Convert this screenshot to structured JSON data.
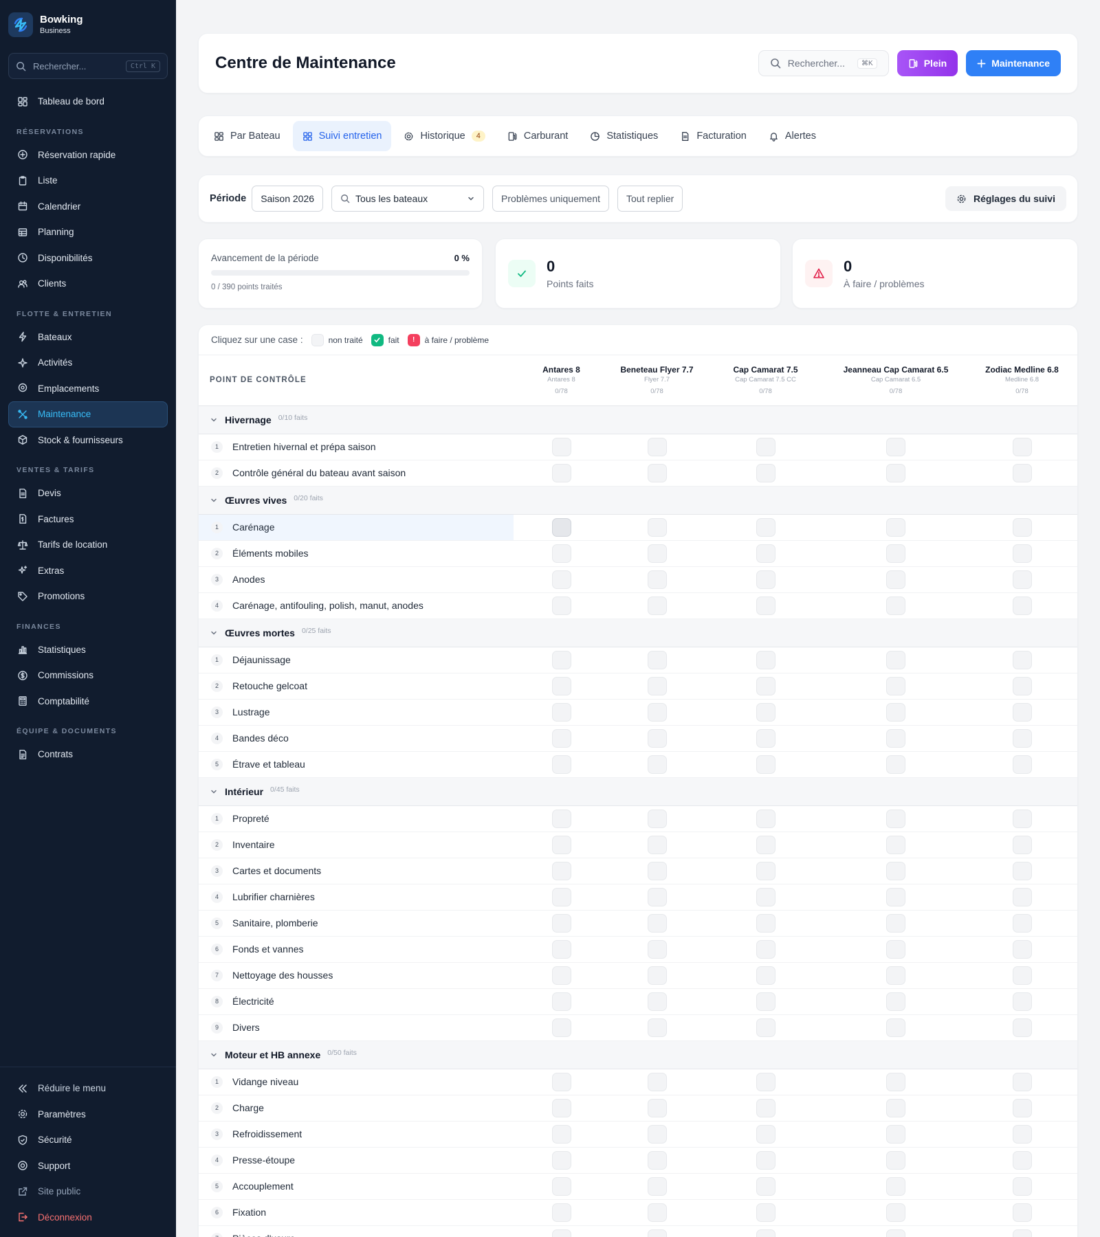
{
  "sidebar": {
    "brand_name": "Bowking",
    "brand_sub": "Business",
    "search_placeholder": "Rechercher...",
    "search_shortcut": "Ctrl K",
    "dashboard": "Tableau de bord",
    "sections": [
      {
        "title": "RÉSERVATIONS",
        "items": [
          {
            "label": "Réservation rapide",
            "icon": "plus-circle-icon"
          },
          {
            "label": "Liste",
            "icon": "clipboard-icon"
          },
          {
            "label": "Calendrier",
            "icon": "calendar-icon"
          },
          {
            "label": "Planning",
            "icon": "table-icon"
          },
          {
            "label": "Disponibilités",
            "icon": "clock-icon"
          },
          {
            "label": "Clients",
            "icon": "users-icon"
          }
        ]
      },
      {
        "title": "FLOTTE & ENTRETIEN",
        "items": [
          {
            "label": "Bateaux",
            "icon": "bolt-icon"
          },
          {
            "label": "Activités",
            "icon": "sparkle-icon"
          },
          {
            "label": "Emplacements",
            "icon": "pin-icon"
          },
          {
            "label": "Maintenance",
            "icon": "wrench-icon",
            "active": true
          },
          {
            "label": "Stock & fournisseurs",
            "icon": "box-icon"
          }
        ]
      },
      {
        "title": "VENTES & TARIFS",
        "items": [
          {
            "label": "Devis",
            "icon": "document-icon"
          },
          {
            "label": "Factures",
            "icon": "invoice-icon"
          },
          {
            "label": "Tarifs de location",
            "icon": "scale-icon"
          },
          {
            "label": "Extras",
            "icon": "sparkles-icon"
          },
          {
            "label": "Promotions",
            "icon": "tag-icon"
          }
        ]
      },
      {
        "title": "FINANCES",
        "items": [
          {
            "label": "Statistiques",
            "icon": "bar-chart-icon"
          },
          {
            "label": "Commissions",
            "icon": "dollar-icon"
          },
          {
            "label": "Comptabilité",
            "icon": "calculator-icon"
          }
        ]
      },
      {
        "title": "ÉQUIPE & DOCUMENTS",
        "items": [
          {
            "label": "Contrats",
            "icon": "contract-icon"
          }
        ]
      }
    ],
    "bottom": {
      "collapse": "Réduire le menu",
      "settings": "Paramètres",
      "security": "Sécurité",
      "support": "Support",
      "public_site": "Site public",
      "logout": "Déconnexion"
    }
  },
  "header": {
    "title": "Centre de Maintenance",
    "search_placeholder": "Rechercher...",
    "search_shortcut": "⌘K",
    "plein_label": "Plein",
    "maintenance_label": "Maintenance"
  },
  "tabs": [
    {
      "label": "Par Bateau"
    },
    {
      "label": "Suivi entretien",
      "active": true
    },
    {
      "label": "Historique",
      "badge": "4"
    },
    {
      "label": "Carburant"
    },
    {
      "label": "Statistiques"
    },
    {
      "label": "Facturation"
    },
    {
      "label": "Alertes"
    }
  ],
  "filters": {
    "period_label": "Période",
    "period_value": "Saison 2026",
    "boats_value": "Tous les bateaux",
    "problems_only": "Problèmes uniquement",
    "collapse_all": "Tout replier",
    "settings": "Réglages du suivi"
  },
  "stats": {
    "progress_label": "Avancement de la période",
    "progress_value": "0 %",
    "progress_fraction": 0,
    "progress_sub": "0 / 390 points traités",
    "done_count": "0",
    "done_label": "Points faits",
    "todo_count": "0",
    "todo_label": "À faire / problèmes"
  },
  "legend": {
    "intro": "Cliquez sur une case :",
    "untreated": "non traité",
    "done": "fait",
    "problem_mark": "!",
    "problem": "à faire / problème"
  },
  "grid": {
    "column_header": "POINT DE CONTRÔLE",
    "boats": [
      {
        "name": "Antares 8",
        "model": "Antares 8",
        "count": "0/78"
      },
      {
        "name": "Beneteau Flyer 7.7",
        "model": "Flyer 7.7",
        "count": "0/78"
      },
      {
        "name": "Cap Camarat 7.5",
        "model": "Cap Camarat 7.5 CC",
        "count": "0/78"
      },
      {
        "name": "Jeanneau Cap Camarat 6.5",
        "model": "Cap Camarat 6.5",
        "count": "0/78"
      },
      {
        "name": "Zodiac Medline 6.8",
        "model": "Medline 6.8",
        "count": "0/78"
      }
    ],
    "categories": [
      {
        "name": "Hivernage",
        "count": "0/10 faits",
        "items": [
          "Entretien hivernal et prépa saison",
          "Contrôle général du bateau avant saison"
        ]
      },
      {
        "name": "Œuvres vives",
        "count": "0/20 faits",
        "items": [
          "Carénage",
          "Éléments mobiles",
          "Anodes",
          "Carénage, antifouling, polish, manut, anodes"
        ]
      },
      {
        "name": "Œuvres mortes",
        "count": "0/25 faits",
        "items": [
          "Déjaunissage",
          "Retouche gelcoat",
          "Lustrage",
          "Bandes déco",
          "Étrave et tableau"
        ]
      },
      {
        "name": "Intérieur",
        "count": "0/45 faits",
        "items": [
          "Propreté",
          "Inventaire",
          "Cartes et documents",
          "Lubrifier charnières",
          "Sanitaire, plomberie",
          "Fonds et vannes",
          "Nettoyage des housses",
          "Électricité",
          "Divers"
        ]
      },
      {
        "name": "Moteur et HB annexe",
        "count": "0/50 faits",
        "items": [
          "Vidange niveau",
          "Charge",
          "Refroidissement",
          "Presse-étoupe",
          "Accouplement",
          "Fixation",
          "Pièces d'usure"
        ]
      }
    ]
  },
  "colors": {
    "sidebar_bg": "#111c2e",
    "accent_blue": "#2f80f6",
    "accent_purple": "#9333ea",
    "done_green": "#10b981",
    "problem_red": "#f43f5e"
  }
}
